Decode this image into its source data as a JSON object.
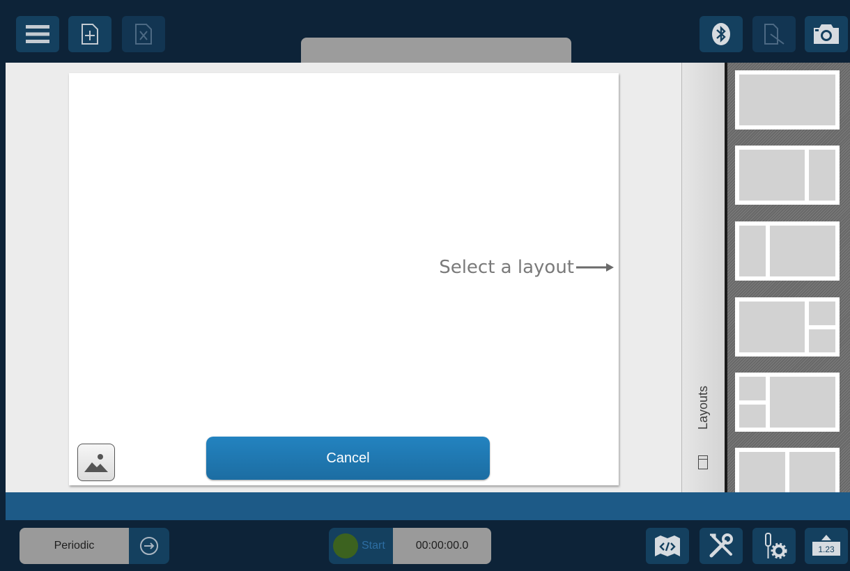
{
  "toolbar": {
    "menu_icon": "hamburger-menu-icon",
    "new_file_icon": "new-file-plus-icon",
    "close_file_icon": "close-file-x-icon",
    "bluetooth_icon": "bluetooth-icon",
    "export_icon": "export-graph-icon",
    "camera_icon": "camera-icon"
  },
  "canvas": {
    "hint": "Select a layout",
    "cancel_label": "Cancel",
    "image_icon": "insert-image-icon"
  },
  "layouts_panel": {
    "tab_label": "Layouts",
    "thumbnails": [
      "single",
      "two-column-wide-left",
      "two-column-wide-right",
      "left-wide-right-split",
      "left-split-right-wide",
      "two-equal-columns"
    ]
  },
  "bottom_bar": {
    "mode_label": "Periodic",
    "start_label": "Start",
    "timer": "00:00:00.0",
    "tools": [
      "code-window-icon",
      "tools-icon",
      "sensor-settings-icon",
      "meter-icon"
    ],
    "meter_value": "1.23"
  },
  "colors": {
    "background": "#0d2338",
    "accent_blue": "#1d5a87",
    "button_blue": "#14405f",
    "cancel_blue": "#1f7ab5"
  }
}
